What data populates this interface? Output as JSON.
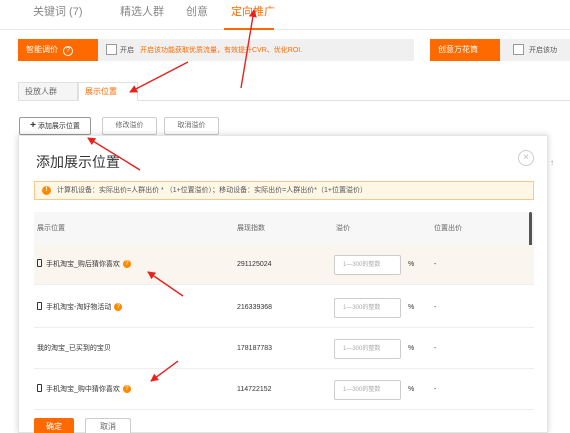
{
  "top_tabs": [
    {
      "label": "关键词 (7)"
    },
    {
      "label": "精选人群"
    },
    {
      "label": "创意"
    },
    {
      "label": "定向推广"
    }
  ],
  "smart_bar": {
    "pill_label": "智能调价",
    "checkbox_label": "开启",
    "hint": "开启该功能获取优质流量，有效提升CVR、优化ROI."
  },
  "right_bar": {
    "pill_label": "创意万花筒",
    "checkbox_label": "开启该功"
  },
  "sub_tabs": [
    {
      "label": "投放人群"
    },
    {
      "label": "展示位置"
    }
  ],
  "actions": {
    "add": "添加展示位置",
    "modify": "修改溢价",
    "cancel": "取消溢价"
  },
  "modal": {
    "title": "添加展示位置",
    "close_glyph": "×",
    "notice": "计算机设备：实际出价=人群出价 * （1+位置溢价）；移动设备：实际出价=人群出价*（1+位置溢价）",
    "columns": [
      "展示位置",
      "展现指数",
      "溢价",
      "位置出价"
    ],
    "rows": [
      {
        "name": "手机淘宝_购后猜你喜欢",
        "index": "291125024",
        "placeholder": "1—300的整数",
        "pct": "%",
        "price": "-"
      },
      {
        "name": "手机淘宝-淘好物活动",
        "index": "216339368",
        "placeholder": "1—300的整数",
        "pct": "%",
        "price": "-"
      },
      {
        "name": "我的淘宝_已买到的宝贝",
        "index": "178187783",
        "placeholder": "1—300的整数",
        "pct": "%",
        "price": "-"
      },
      {
        "name": "手机淘宝_购中猜你喜欢",
        "index": "114722152",
        "placeholder": "1—300的整数",
        "pct": "%",
        "price": "-"
      }
    ],
    "ok_label": "确定",
    "cancel_label": "取消"
  },
  "colors": {
    "accent": "#ff6a00",
    "annotation_arrow": "#e8211c"
  }
}
